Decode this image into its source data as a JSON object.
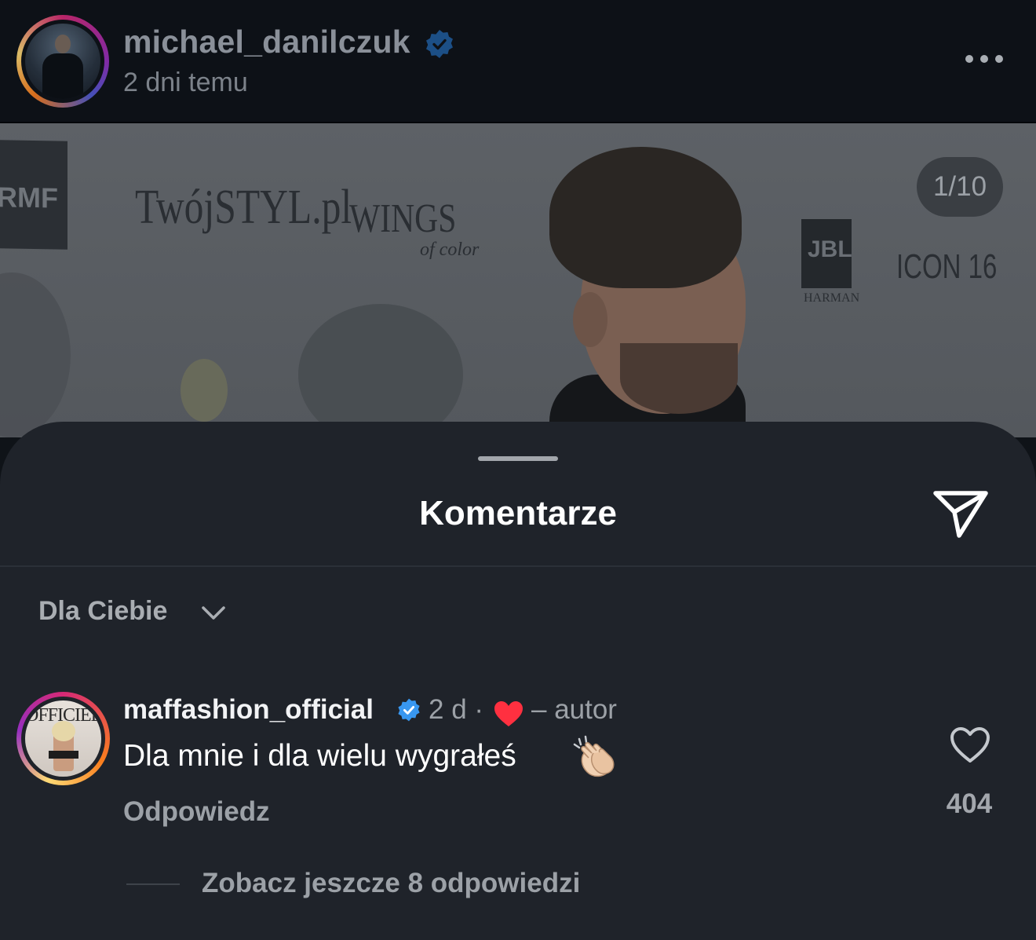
{
  "post": {
    "username": "michael_danilczuk",
    "time_ago": "2 dni temu",
    "verified": true,
    "more_icon": "more-dots-icon"
  },
  "media": {
    "counter": "1/10",
    "sponsors": [
      "RMF",
      "TwójSTYL.pl",
      "WINGS",
      "of color",
      "JBL",
      "HARMAN",
      "ICON 16"
    ]
  },
  "comments_sheet": {
    "title": "Komentarze",
    "send_icon": "send-icon",
    "sort": {
      "label": "Dla Ciebie",
      "icon": "chevron-down-icon"
    },
    "comments": [
      {
        "username": "maffashion_official",
        "verified": true,
        "time": "2 d ·",
        "author_like": "– autor",
        "text": "Dla mnie i dla wielu wygrałeś",
        "emoji": "clapping-hands",
        "reply_label": "Odpowiedz",
        "like_count": "404",
        "view_replies": "Zobacz jeszcze 8 odpowiedzi"
      }
    ]
  },
  "colors": {
    "verified_blue": "#3897f0",
    "heart_red": "#ff3040",
    "sheet_bg": "#1f232a",
    "header_bg": "#0d1117"
  }
}
